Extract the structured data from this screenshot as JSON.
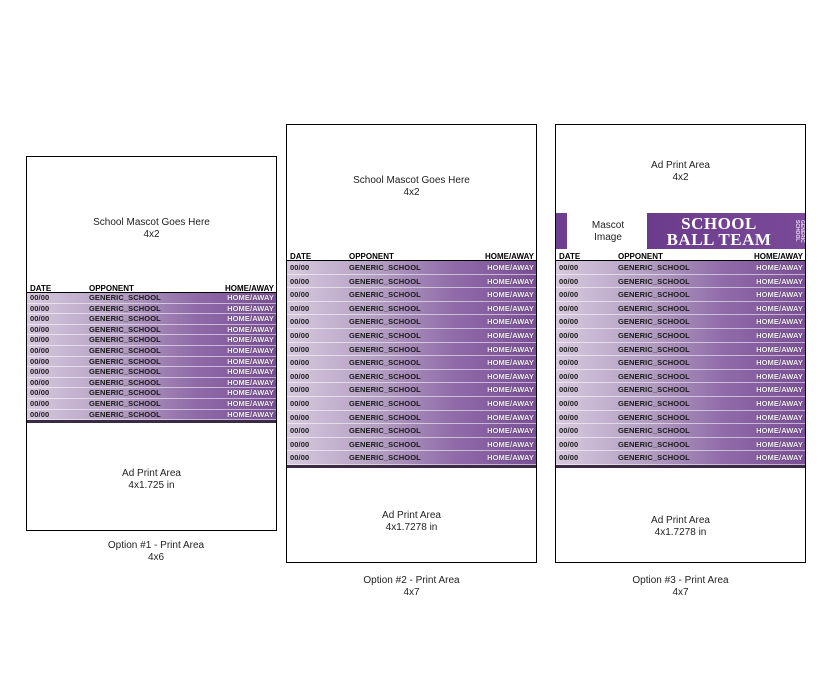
{
  "columns": {
    "date": "DATE",
    "opponent": "OPPONENT",
    "home_away": "HOME/AWAY"
  },
  "row_values": {
    "date": "00/00",
    "opponent": "GENERIC_SCHOOL",
    "home_away": "HOME/AWAY"
  },
  "colors": {
    "purple_dark": "#6b3c8b",
    "purple_light": "#d7c9de"
  },
  "option1": {
    "top_text": "School Mascot Goes Here",
    "top_size": "4x2",
    "ad_text": "Ad Print Area",
    "ad_size": "4x1.725 in",
    "caption": "Option #1 - Print Area",
    "caption_size": "4x6",
    "row_count": 12
  },
  "option2": {
    "top_text": "School Mascot Goes Here",
    "top_size": "4x2",
    "ad_text": "Ad Print Area",
    "ad_size": "4x1.7278 in",
    "caption": "Option #2 - Print Area",
    "caption_size": "4x7",
    "row_count": 15
  },
  "option3": {
    "top_text": "Ad Print Area",
    "top_size": "4x2",
    "mascot_label": "Mascot Image",
    "banner_line1": "SCHOOL",
    "banner_line2": "BALL TEAM",
    "banner_side": "GENERIC SCHOOL",
    "ad_text": "Ad Print Area",
    "ad_size": "4x1.7278 in",
    "caption": "Option #3 - Print Area",
    "caption_size": "4x7",
    "row_count": 15
  }
}
